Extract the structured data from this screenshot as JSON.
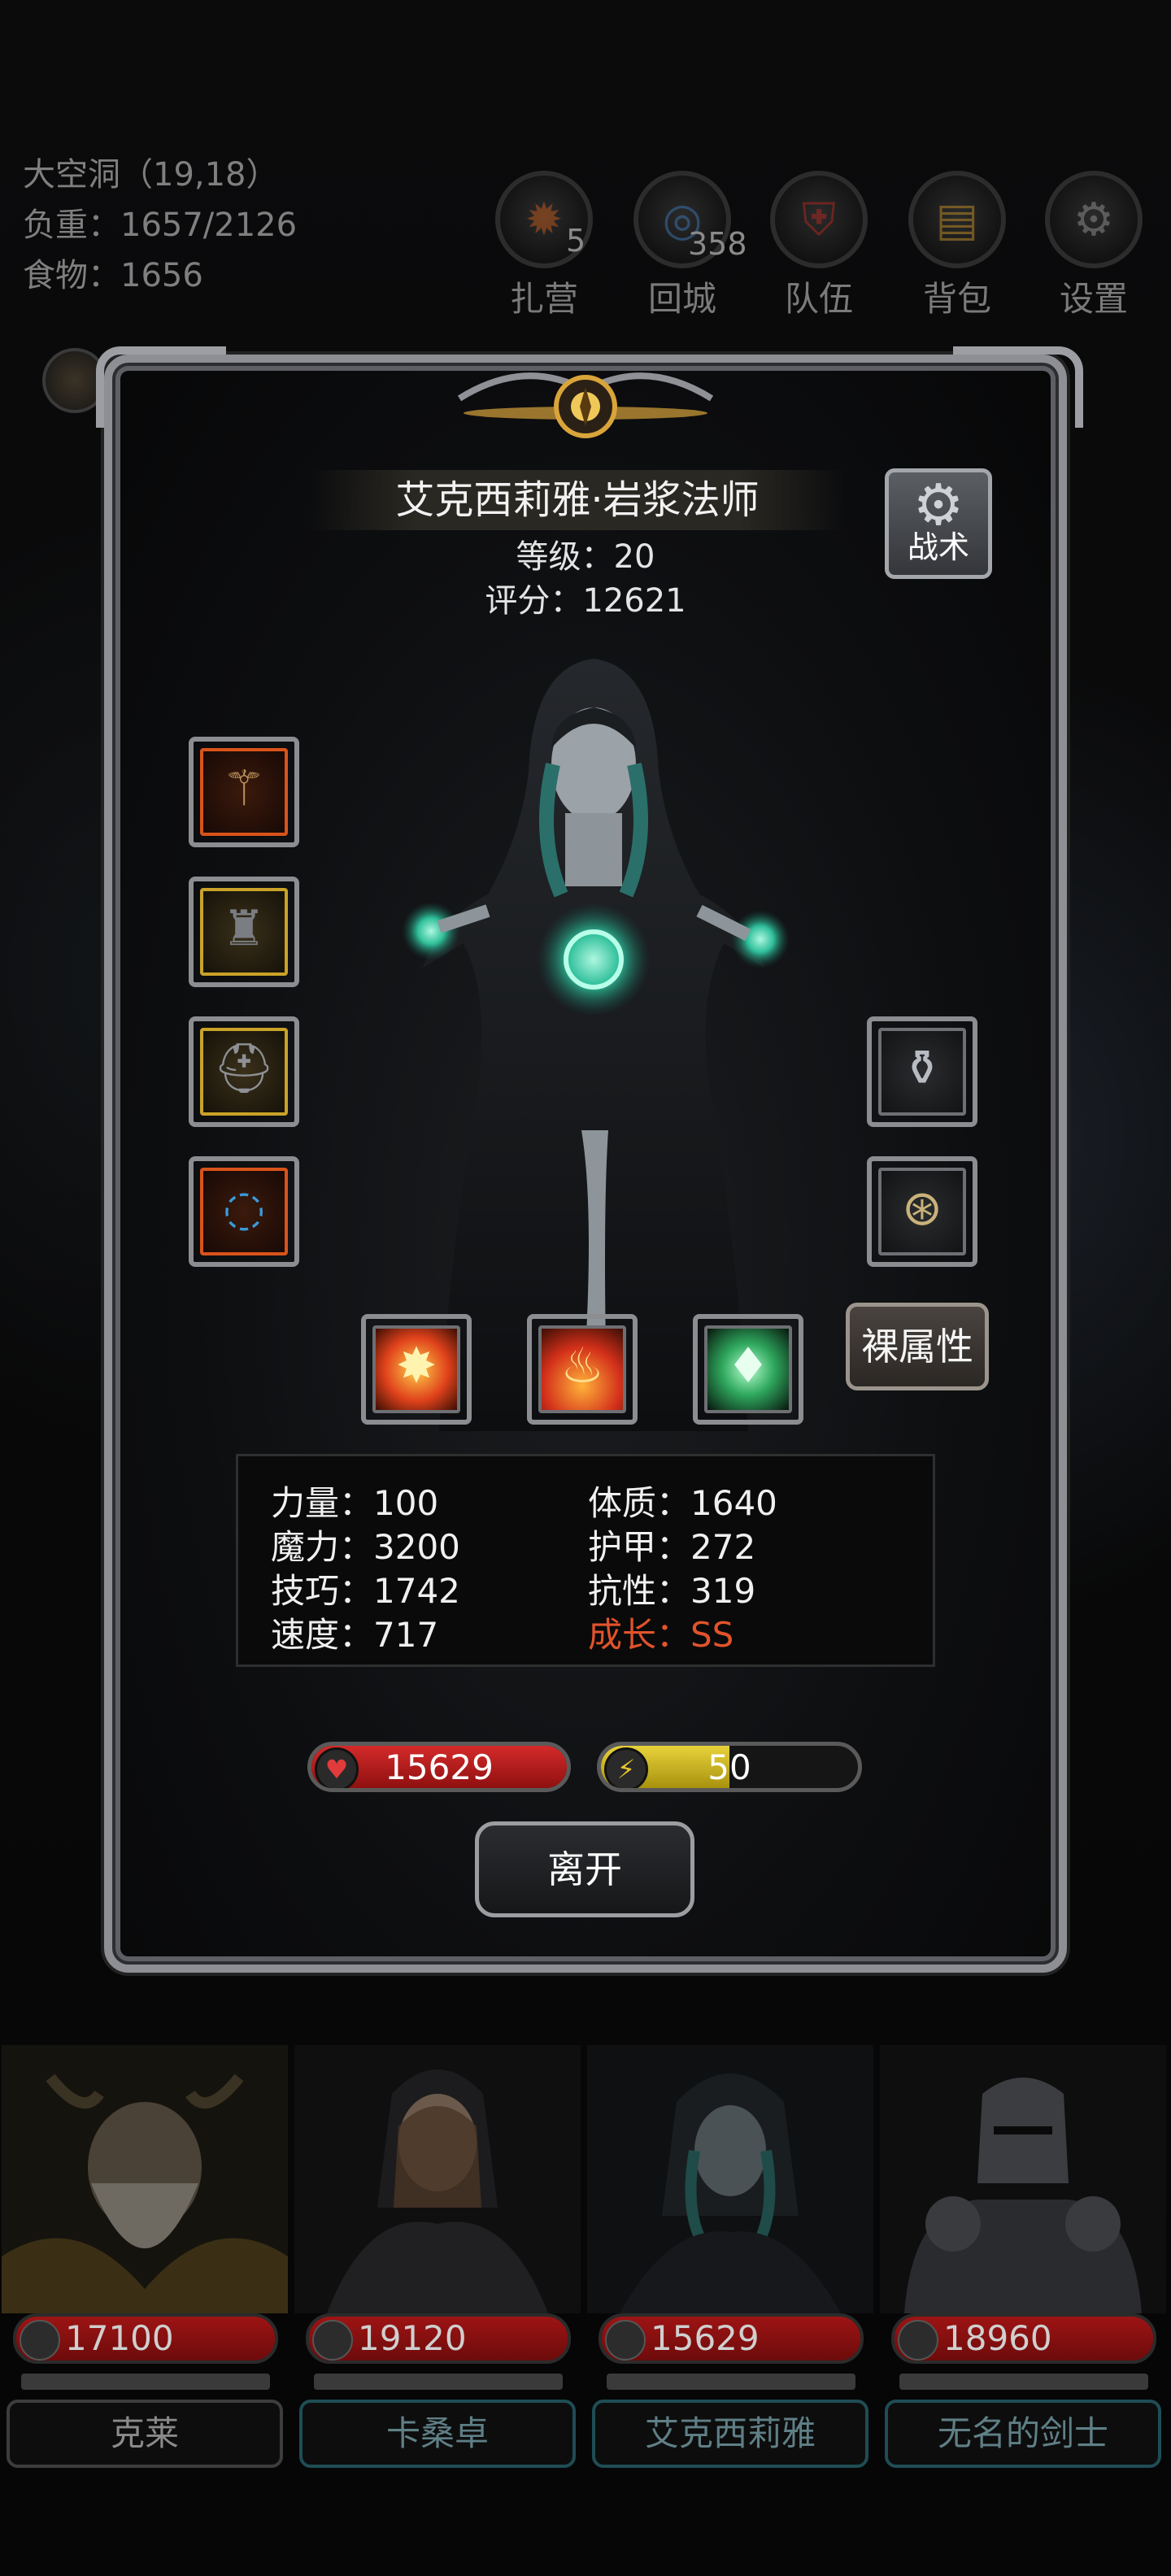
{
  "hud": {
    "location": "大空洞（19,18）",
    "weight": "负重：1657/2126",
    "food": "食物：1656",
    "buttons": [
      {
        "label": "扎营",
        "count": "5",
        "icon": "campfire-icon"
      },
      {
        "label": "回城",
        "count": "358",
        "icon": "portal-icon"
      },
      {
        "label": "队伍",
        "count": "",
        "icon": "party-icon"
      },
      {
        "label": "背包",
        "count": "",
        "icon": "backpack-icon"
      },
      {
        "label": "设置",
        "count": "",
        "icon": "gear-icon"
      }
    ]
  },
  "character": {
    "name": "艾克西莉雅·岩浆法师",
    "level": "等级：20",
    "score": "评分：12621",
    "tactics_label": "战术",
    "bare_stats_label": "裸属性",
    "equipment_left": [
      {
        "icon": "staff-icon",
        "rarity": "orange"
      },
      {
        "icon": "robe-icon",
        "rarity": "gold"
      },
      {
        "icon": "helmet-icon",
        "rarity": "gold"
      },
      {
        "icon": "amulet-icon",
        "rarity": "orange"
      }
    ],
    "equipment_right": [
      {
        "icon": "potion-icon",
        "rarity": "grey"
      },
      {
        "icon": "compass-icon",
        "rarity": "grey"
      }
    ],
    "skills": [
      {
        "icon": "explosion-icon"
      },
      {
        "icon": "fire-icon"
      },
      {
        "icon": "crystal-icon"
      }
    ],
    "stats": {
      "strength": "力量：100",
      "magic": "魔力：3200",
      "skill": "技巧：1742",
      "speed": "速度：717",
      "constitution": "体质：1640",
      "armor": "护甲：272",
      "resistance": "抗性：319",
      "growth": "成长：SS"
    },
    "hp": "15629",
    "hp_fraction": 1.0,
    "energy": "50",
    "energy_fraction": 0.5,
    "leave_label": "离开"
  },
  "party": [
    {
      "name": "克莱",
      "hp": "17100"
    },
    {
      "name": "卡桑卓",
      "hp": "19120"
    },
    {
      "name": "艾克西莉雅",
      "hp": "15629"
    },
    {
      "name": "无名的剑士",
      "hp": "18960"
    }
  ],
  "colors": {
    "hp_red": "#c11a1a",
    "energy_yellow": "#d9c21a",
    "growth_orange": "#e2532b",
    "rarity_orange": "#d9531a",
    "rarity_gold": "#c9a227"
  }
}
